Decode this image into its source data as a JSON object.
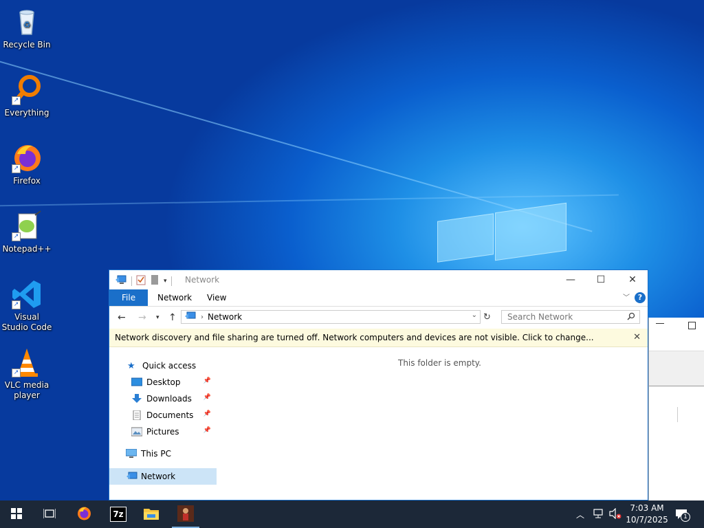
{
  "desktop": {
    "icons": [
      {
        "label": "Recycle Bin"
      },
      {
        "label": "Everything"
      },
      {
        "label": "Firefox"
      },
      {
        "label": "Notepad++"
      },
      {
        "label": "Visual Studio Code"
      },
      {
        "label": "VLC media player"
      }
    ]
  },
  "explorer": {
    "title": "Network",
    "tabs": {
      "file": "File",
      "network": "Network",
      "view": "View"
    },
    "address": {
      "crumb": "Network"
    },
    "search": {
      "placeholder": "Search Network"
    },
    "infobar": {
      "message": "Network discovery and file sharing are turned off. Network computers and devices are not visible. Click to change..."
    },
    "nav": {
      "quick_access": "Quick access",
      "desktop": "Desktop",
      "downloads": "Downloads",
      "documents": "Documents",
      "pictures": "Pictures",
      "this_pc": "This PC",
      "network": "Network"
    },
    "empty_message": "This folder is empty."
  },
  "taskbar": {
    "pinned": [
      "start-icon",
      "task-view-icon",
      "firefox-icon",
      "7zip-icon",
      "file-explorer-icon",
      "app-icon"
    ],
    "sevenzip_label": "7z",
    "time": "7:03 AM",
    "date": "10/7/2025",
    "notification_count": "1"
  },
  "colors": {
    "accent": "#1a6fc9",
    "taskbar": "#1c2838",
    "infobar": "#fdfadf",
    "selection": "#cce4f7"
  }
}
